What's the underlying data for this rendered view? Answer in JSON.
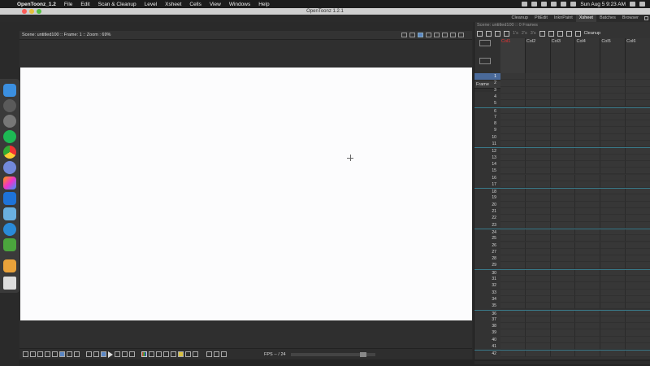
{
  "menubar": {
    "app": "OpenToonz_1.2",
    "items": [
      "File",
      "Edit",
      "Scan & Cleanup",
      "Level",
      "Xsheet",
      "Cells",
      "View",
      "Windows",
      "Help"
    ],
    "clock": "Sun Aug 5  9:23 AM"
  },
  "window": {
    "title": "OpenToonz 1.2.1"
  },
  "rooms": [
    "Cleanup",
    "PltEdit",
    "InknPaint",
    "Xsheet",
    "Batches",
    "Browser"
  ],
  "active_room": "Xsheet",
  "viewer": {
    "info": "Scene: untitled100  ::  Frame: 1  ::  Zoom : 69%"
  },
  "playback": {
    "fps": "FPS -- / 24"
  },
  "xsheet": {
    "scene_info": "Scene: untitled100  ::  0 Frames",
    "steps": [
      "1's",
      "2's",
      "3's"
    ],
    "cleanup_label": "Cleanup",
    "frame_label": "Frame",
    "columns": [
      "Col1",
      "Col2",
      "Col3",
      "Col4",
      "Col5",
      "Col6"
    ],
    "rows": [
      "1",
      "2",
      "3",
      "4",
      "5",
      "6",
      "7",
      "8",
      "9",
      "10",
      "11",
      "12",
      "13",
      "14",
      "15",
      "16",
      "17",
      "18",
      "19",
      "20",
      "21",
      "22",
      "23",
      "24",
      "25",
      "26",
      "27",
      "28",
      "29",
      "30",
      "31",
      "32",
      "33",
      "34",
      "35",
      "36",
      "37",
      "38",
      "39",
      "40",
      "41",
      "42"
    ]
  },
  "colors": {
    "accent": "#5a86c4",
    "marker": "#3a7a8a",
    "canvas": "#fcfcfd"
  }
}
